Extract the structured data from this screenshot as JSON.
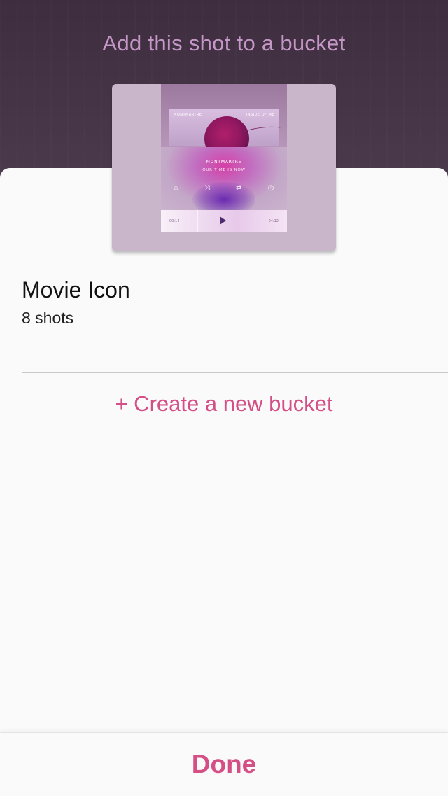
{
  "header": {
    "title": "Add this shot to a bucket"
  },
  "thumbnail": {
    "brand_left": "MONTMARTRE",
    "brand_right": "INSIDE OF ME",
    "title": "MONTMARTRE",
    "subtitle": "OUR TIME IS NOW",
    "time_left": "00:14",
    "time_right": "04:12",
    "controls": [
      "home-icon",
      "shuffle-icon",
      "repeat-icon",
      "timer-icon"
    ]
  },
  "bucket": {
    "name": "Movie Icon",
    "count": "8 shots"
  },
  "actions": {
    "create": "+ Create a new bucket",
    "done": "Done"
  },
  "colors": {
    "accent": "#d34f86",
    "header_text": "#c497c6",
    "header_bg": "#433244"
  }
}
